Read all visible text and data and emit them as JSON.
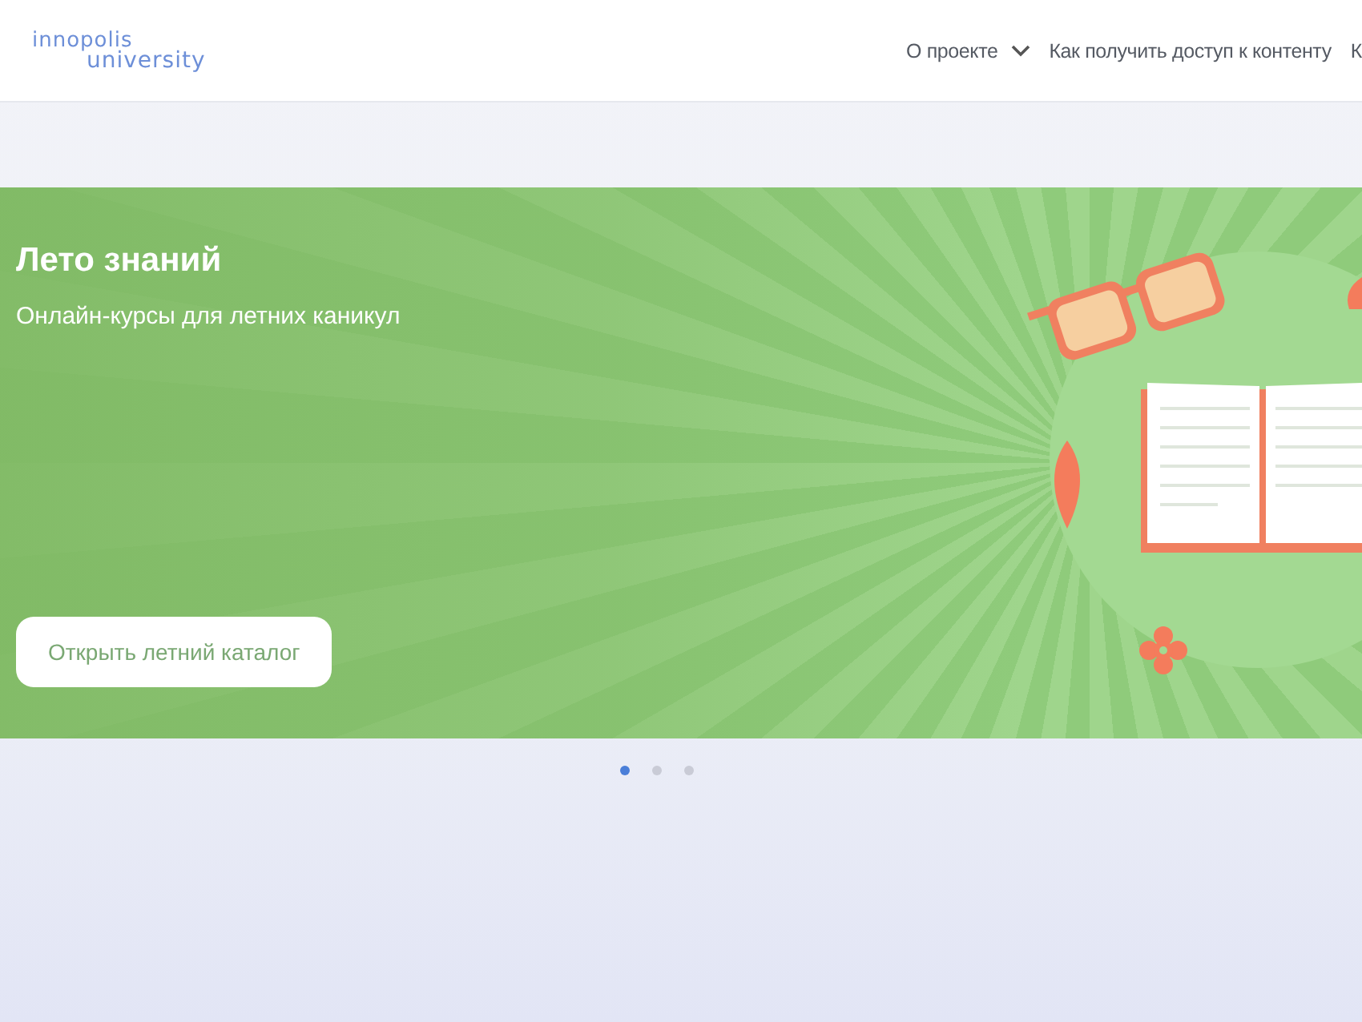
{
  "header": {
    "logo": {
      "line_1": "innopolis",
      "line_2": "university"
    },
    "nav": [
      {
        "label": "О проекте",
        "dropdown": true
      },
      {
        "label": "Как получить доступ к контенту",
        "dropdown": false
      },
      {
        "label": "К",
        "dropdown": false
      }
    ]
  },
  "banner": {
    "title": "Лето знаний",
    "subtitle": "Онлайн-курсы для летних каникул",
    "button": "Открыть летний каталог"
  },
  "carousel_dots": [
    {
      "selected": true
    },
    {
      "selected": false
    },
    {
      "selected": false
    }
  ]
}
